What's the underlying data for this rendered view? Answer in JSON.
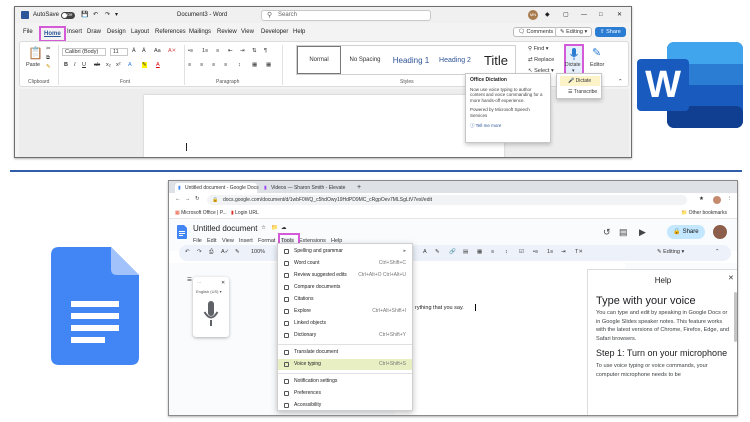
{
  "word": {
    "titlebar": {
      "autosave": "AutoSave",
      "toggle_state": "Off",
      "doc_title": "Document3 - Word",
      "search_placeholder": "Search",
      "user_initials": "MN"
    },
    "tabs": [
      "File",
      "Home",
      "Insert",
      "Draw",
      "Design",
      "Layout",
      "References",
      "Mailings",
      "Review",
      "View",
      "Developer",
      "Help"
    ],
    "active_tab": "Home",
    "buttons": {
      "comments": "Comments",
      "editing": "Editing",
      "share": "Share"
    },
    "ribbon": {
      "paste": "Paste",
      "font_name": "Calibri (Body)",
      "font_size": "11",
      "groups": {
        "clipboard": "Clipboard",
        "font": "Font",
        "paragraph": "Paragraph",
        "styles": "Styles"
      },
      "styles": [
        "Normal",
        "No Spacing",
        "Heading 1",
        "Heading 2",
        "Title"
      ],
      "editing": {
        "find": "Find",
        "replace": "Replace",
        "select": "Select"
      },
      "dictate": "Dictate",
      "editor": "Editor"
    },
    "tooltip": {
      "title": "Office Dictation",
      "body": "Now use voice typing to author content and voice commanding for a more hands-off experience.",
      "powered": "Powered by Microsoft Speech Services",
      "tell_more": "Tell me more"
    },
    "dictate_menu": [
      "Dictate",
      "Transcribe"
    ]
  },
  "word_logo_letter": "W",
  "gdocs": {
    "chrome_tabs": [
      "Untitled document - Google Docs",
      "Videos — Sharon Smith - Elevate"
    ],
    "url": "docs.google.com/document/d/1wbF0WQ_c5hdOwy19HdPD9MC_cRgpOev7MLSgLtV7exl/edit",
    "bookmarks": [
      "Microsoft Office | P...",
      "Login URL"
    ],
    "other_bookmarks": "Other bookmarks",
    "doc_title": "Untitled document",
    "menus": [
      "File",
      "Edit",
      "View",
      "Insert",
      "Format",
      "Tools",
      "Extensions",
      "Help"
    ],
    "active_menu": "Tools",
    "share": "Share",
    "editing": "Editing",
    "zoom": "100%",
    "voice_lang": "English (US)",
    "body_text": "rything that you say.",
    "tools_menu": [
      {
        "label": "Spelling and grammar",
        "shortcut": ""
      },
      {
        "label": "Word count",
        "shortcut": "Ctrl+Shift+C"
      },
      {
        "label": "Review suggested edits",
        "shortcut": "Ctrl+Alt+O Ctrl+Alt+U"
      },
      {
        "label": "Compare documents",
        "shortcut": ""
      },
      {
        "label": "Citations",
        "shortcut": ""
      },
      {
        "label": "Explore",
        "shortcut": "Ctrl+Alt+Shift+I"
      },
      {
        "label": "Linked objects",
        "shortcut": ""
      },
      {
        "label": "Dictionary",
        "shortcut": "Ctrl+Shift+Y"
      },
      {
        "label": "Translate document",
        "shortcut": ""
      },
      {
        "label": "Voice typing",
        "shortcut": "Ctrl+Shift+S"
      },
      {
        "label": "Notification settings",
        "shortcut": ""
      },
      {
        "label": "Preferences",
        "shortcut": ""
      },
      {
        "label": "Accessibility",
        "shortcut": ""
      }
    ],
    "help": {
      "title": "Help",
      "h1": "Type with your voice",
      "p1": "You can type and edit by speaking in Google Docs or in Google Slides speaker notes. This feature works with the latest versions of Chrome, Firefox, Edge, and Safari browsers.",
      "h2": "Step 1: Turn on your microphone",
      "p2": "To use voice typing or voice commands, your computer microphone needs to be"
    }
  }
}
